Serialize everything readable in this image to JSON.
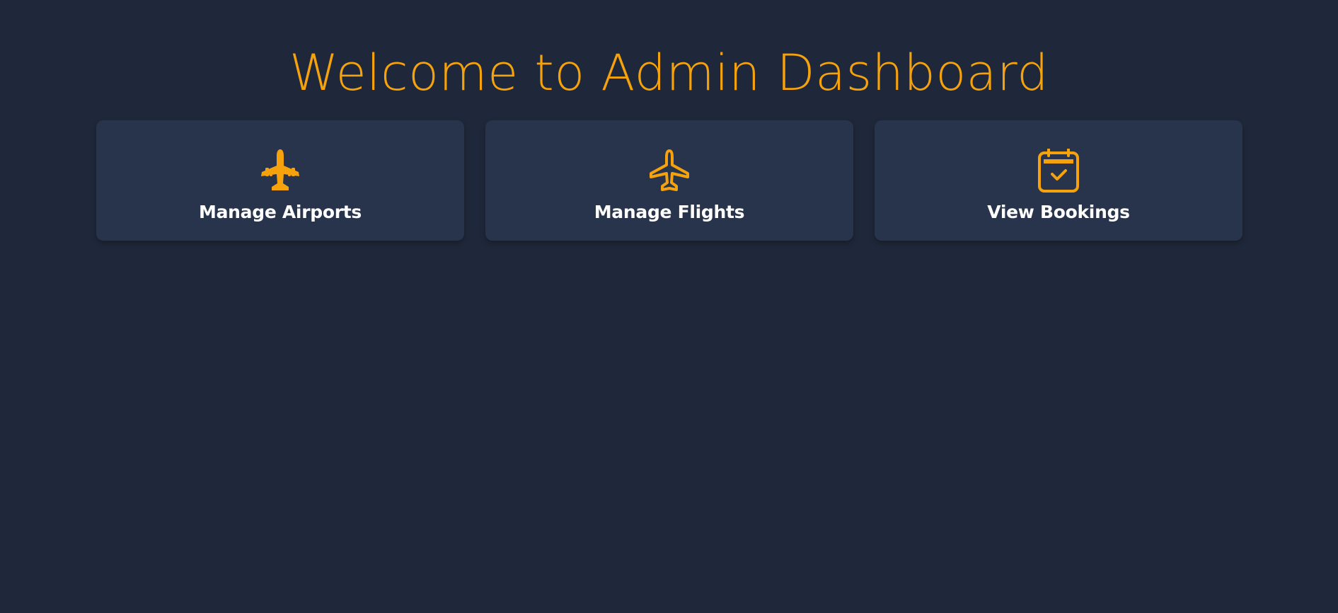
{
  "page": {
    "title": "Welcome to Admin Dashboard"
  },
  "theme": {
    "background": "#1f283a",
    "card_background": "#28344b",
    "accent": "#f5a20c",
    "label_color": "#ffffff"
  },
  "cards": [
    {
      "label": "Manage Airports",
      "icon": "fighter-jet-icon"
    },
    {
      "label": "Manage Flights",
      "icon": "airplane-outline-icon"
    },
    {
      "label": "View Bookings",
      "icon": "calendar-check-icon"
    }
  ]
}
